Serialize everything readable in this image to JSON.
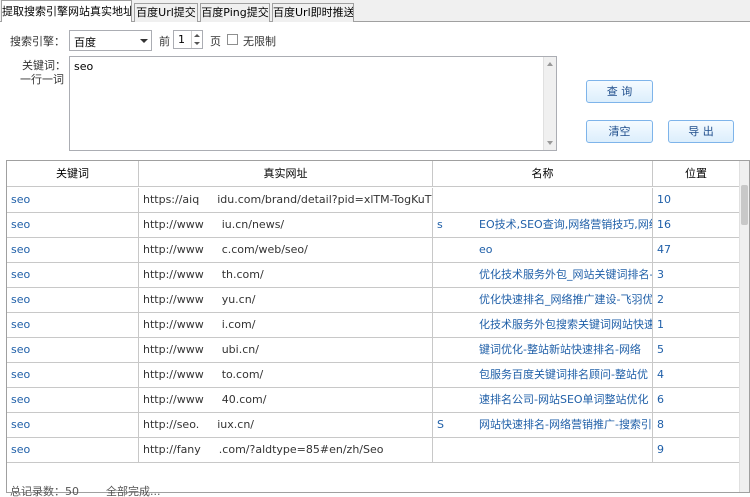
{
  "tabs": [
    {
      "label": "提取搜索引擎网站真实地址",
      "active": true
    },
    {
      "label": "百度Url提交",
      "active": false
    },
    {
      "label": "百度Ping提交",
      "active": false
    },
    {
      "label": "百度Url即时推送",
      "active": false
    }
  ],
  "form": {
    "engine_label": "搜索引擎：",
    "engine_value": "百度",
    "pages_prefix": "前",
    "pages_value": "1",
    "pages_suffix": "页",
    "unlimited_label": "无限制",
    "keyword_label_line1": "关键词：",
    "keyword_label_line2": "一行一词",
    "keyword_value": "seo"
  },
  "buttons": {
    "query": "查 询",
    "clear": "清空",
    "export": "导 出"
  },
  "grid": {
    "columns": [
      "关键词",
      "真实网址",
      "名称",
      "位置"
    ],
    "rows": [
      {
        "keyword": "seo",
        "url": "https://aiq",
        "url_tail": "idu.com/brand/detail?pid=xlTM-TogKuTv",
        "name_head": "",
        "name_tail": "",
        "position": "10"
      },
      {
        "keyword": "seo",
        "url": "http://www",
        "url_tail": "iu.cn/news/",
        "name_head": "s",
        "name_tail": "EO技术,SEO查询,网络营销技巧,网络",
        "position": "16"
      },
      {
        "keyword": "seo",
        "url": "http://www",
        "url_tail": "c.com/web/seo/",
        "name_head": "",
        "name_tail": "eo",
        "position": "47"
      },
      {
        "keyword": "seo",
        "url": "http://www",
        "url_tail": "th.com/",
        "name_head": "",
        "name_tail": "优化技术服务外包_网站关键词排名-",
        "position": "3"
      },
      {
        "keyword": "seo",
        "url": "http://www",
        "url_tail": "yu.cn/",
        "name_head": "",
        "name_tail": "优化快速排名_网络推广建设-飞羽优",
        "position": "2"
      },
      {
        "keyword": "seo",
        "url": "http://www",
        "url_tail": "i.com/",
        "name_head": "",
        "name_tail": "化技术服务外包搜索关键词网站快速",
        "position": "1"
      },
      {
        "keyword": "seo",
        "url": "http://www",
        "url_tail": "ubi.cn/",
        "name_head": "",
        "name_tail": "键词优化-整站新站快速排名-网络",
        "position": "5"
      },
      {
        "keyword": "seo",
        "url": "http://www",
        "url_tail": "to.com/",
        "name_head": "",
        "name_tail": "包服务百度关键词排名顾问-整站优",
        "position": "4"
      },
      {
        "keyword": "seo",
        "url": "http://www",
        "url_tail": "40.com/",
        "name_head": "",
        "name_tail": "速排名公司-网站SEO单词整站优化",
        "position": "6"
      },
      {
        "keyword": "seo",
        "url": "http://seo.",
        "url_tail": "iux.cn/",
        "name_head": "S",
        "name_tail": "网站快速排名-网络营销推广-搜索引",
        "position": "8"
      },
      {
        "keyword": "seo",
        "url": "http://fany",
        "url_tail": ".com/?aldtype=85#en/zh/Seo",
        "name_head": "",
        "name_tail": "",
        "position": "9"
      }
    ]
  },
  "status": {
    "total": "总记录数：50",
    "done": "全部完成..."
  }
}
